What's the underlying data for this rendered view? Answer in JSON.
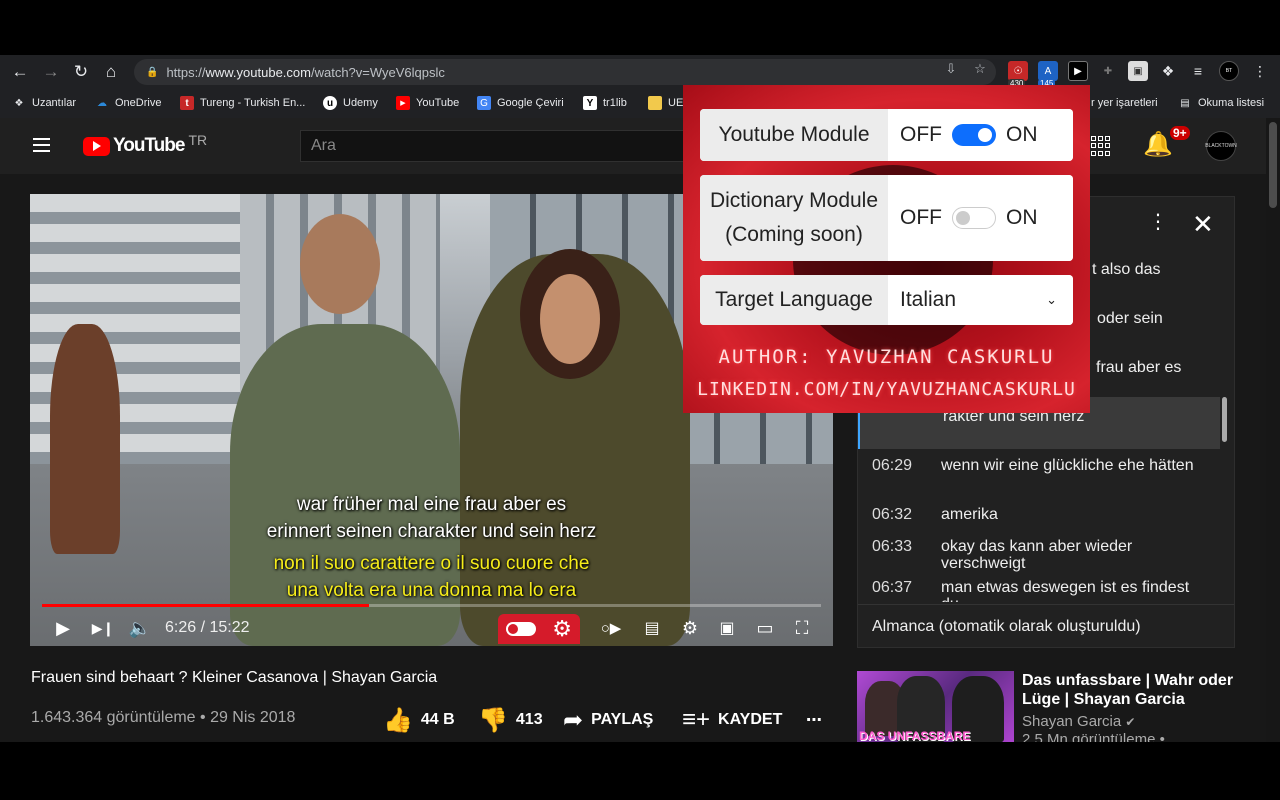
{
  "browser": {
    "url_scheme": "https://",
    "url_host": "www.youtube.com",
    "url_path": "/watch?v=WyeV6lqpslc",
    "extensions": [
      {
        "name": "adblock-ext-icon",
        "badge": "430",
        "color": "#c62828"
      },
      {
        "name": "translate-ext-icon",
        "badge": "145",
        "color": "#1e63c4"
      },
      {
        "name": "media-ext-icon",
        "badge": "",
        "color": "#000000"
      }
    ],
    "bookmarks": [
      {
        "label": "Uzantılar",
        "icon": "puzzle-icon"
      },
      {
        "label": "OneDrive",
        "icon": "cloud-icon"
      },
      {
        "label": "Tureng - Turkish En...",
        "icon": "tureng-icon"
      },
      {
        "label": "Udemy",
        "icon": "udemy-icon"
      },
      {
        "label": "YouTube",
        "icon": "youtube-icon"
      },
      {
        "label": "Google Çeviri",
        "icon": "translate-icon"
      },
      {
        "label": "tr1lib",
        "icon": "library-icon"
      },
      {
        "label": "UE",
        "icon": "folder-icon"
      },
      {
        "label": "r yer işaretleri",
        "icon": ""
      },
      {
        "label": "Okuma listesi",
        "icon": "reading-list-icon"
      }
    ]
  },
  "youtube": {
    "logo_text": "YouTube",
    "country": "TR",
    "search_placeholder": "Ara",
    "notifications_badge": "9+",
    "avatar_text": "BLACKTOWN"
  },
  "player": {
    "subtitle_de_1": "war früher mal eine frau aber es",
    "subtitle_de_2": "erinnert seinen charakter und sein herz",
    "subtitle_it_1": "non il suo carattere o il suo cuore che",
    "subtitle_it_2": "una volta era una donna ma lo era",
    "time_current": "6:26",
    "time_total": "15:22",
    "progress": 0.42
  },
  "transcript": {
    "rows": [
      {
        "ts": "",
        "text": "t also das"
      },
      {
        "ts": "",
        "text": "oder sein"
      },
      {
        "ts": "",
        "text": "frau aber es"
      },
      {
        "ts": "",
        "text": "rakter und sein herz"
      },
      {
        "ts": "06:29",
        "text": "wenn wir eine glückliche ehe hätten"
      },
      {
        "ts": "06:32",
        "text": "amerika"
      },
      {
        "ts": "06:33",
        "text": "okay das kann aber wieder verschweigt"
      },
      {
        "ts": "06:37",
        "text": "man etwas deswegen ist es findest du"
      }
    ],
    "language": "Almanca (otomatik olarak oluşturuldu)"
  },
  "video": {
    "title": "Frauen sind behaart ? Kleiner Casanova | Shayan Garcia",
    "views": "1.643.364 görüntüleme • 29 Nis 2018",
    "likes": "44 B",
    "dislikes": "413",
    "share_label": "PAYLAŞ",
    "save_label": "KAYDET"
  },
  "recommended": {
    "thumb_text": "DAS UNFASSBARE",
    "title": "Das unfassbare | Wahr oder Lüge | Shayan Garcia",
    "channel": "Shayan Garcia",
    "views": "2,5 Mn görüntüleme •"
  },
  "popup": {
    "youtube_module_label": "Youtube Module",
    "dictionary_module_label_1": "Dictionary Module",
    "dictionary_module_label_2": "(Coming soon)",
    "off_label": "OFF",
    "on_label": "ON",
    "target_language_label": "Target Language",
    "target_language_value": "Italian",
    "youtube_module_on": true,
    "dictionary_module_on": false,
    "author_line": "AUTHOR: YAVUZHAN CASKURLU",
    "linkedin_line": "LINKEDIN.COM/IN/YAVUZHANCASKURLU"
  }
}
